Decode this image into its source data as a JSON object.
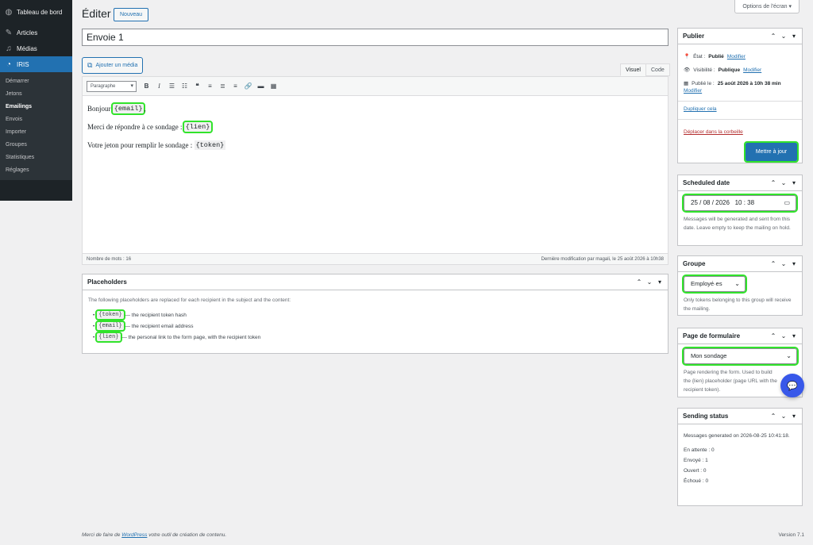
{
  "sidebar": {
    "dashboard": "Tableau de bord",
    "articles": "Articles",
    "medias": "Médias",
    "iris": "IRIS",
    "submenu": [
      "Démarrer",
      "Jetons",
      "Emailings",
      "Envois",
      "Importer",
      "Groupes",
      "Statistiques",
      "Réglages"
    ]
  },
  "header": {
    "title": "Éditer",
    "new_button": "Nouveau",
    "screen_options": "Options de l'écran ▾"
  },
  "post": {
    "title": "Envoie 1",
    "add_media": "Ajouter un média",
    "tab_visual": "Visuel",
    "tab_code": "Code",
    "format": "Paragraphe",
    "line1_prefix": "Bonjour",
    "line1_code": "{email}",
    "line1_suffix": ",",
    "line2_prefix": "Merci de répondre à ce sondage  :",
    "line2_code": "{lien}",
    "line3_prefix": "Votre jeton pour remplir le sondage :",
    "line3_code": "{token}",
    "word_count": "Nombre de mots : 16",
    "last_modified": "Dernière modification par magali, le 25 août 2026 à 10h38"
  },
  "placeholders": {
    "title": "Placeholders",
    "intro": "The following placeholders are replaced for each recipient in the subject and the content:",
    "items": [
      {
        "code": "{token}",
        "desc": "— the recipient token hash"
      },
      {
        "code": "{email}",
        "desc": "— the recipient email address"
      },
      {
        "code": "{lien}",
        "desc": "— the personal link to the form page, with the recipient token"
      }
    ]
  },
  "publish": {
    "title": "Publier",
    "status_label": "État :",
    "status_value": "Publié",
    "visibility_label": "Visibilité :",
    "visibility_value": "Publique",
    "published_label": "Publié le :",
    "published_value": "25 août 2026 à 10h 38 min",
    "modify": "Modifier",
    "duplicate": "Dupliquer cela",
    "trash": "Déplacer dans la corbeille",
    "update": "Mettre à jour"
  },
  "scheduled": {
    "title": "Scheduled date",
    "value": "25 / 08 / 2026   10 : 38",
    "desc": "Messages will be generated and sent from this date. Leave empty to keep the mailing on hold."
  },
  "groupe": {
    "title": "Groupe",
    "value": "Employé·es",
    "desc": "Only tokens belonging to this group will receive the mailing."
  },
  "formulaire": {
    "title": "Page de formulaire",
    "value": "Mon sondage",
    "desc": "Page rendering the form. Used to build the {lien} placeholder (page URL with the recipient token)."
  },
  "sending": {
    "title": "Sending status",
    "generated": "Messages generated on 2026-08-25 10:41:18.",
    "pending": "En attente : 0",
    "sent": "Envoyé : 1",
    "opened": "Ouvert : 0",
    "failed": "Échoué : 0"
  },
  "footer": {
    "left_prefix": "Merci de faire de",
    "left_link": "WordPress",
    "left_suffix": "votre outil de création de contenu.",
    "version": "Version 7.1"
  },
  "colors": {
    "accent": "#2271b1",
    "highlight": "#31e32b",
    "sidebar": "#1d2327"
  }
}
